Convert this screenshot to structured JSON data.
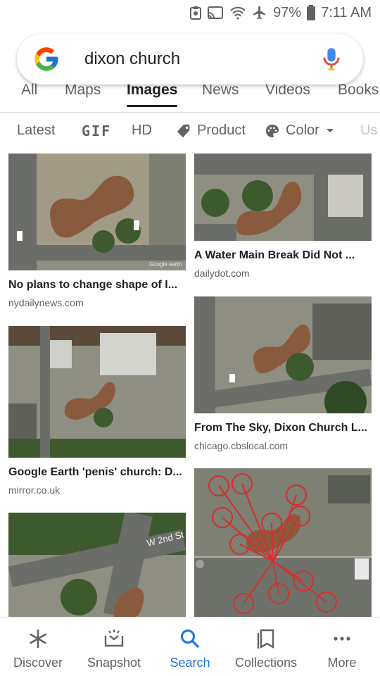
{
  "status_bar": {
    "battery": "97%",
    "time": "7:11 AM"
  },
  "search": {
    "query": "dixon church"
  },
  "tabs": [
    {
      "label": "All"
    },
    {
      "label": "Maps"
    },
    {
      "label": "Images"
    },
    {
      "label": "News"
    },
    {
      "label": "Videos"
    },
    {
      "label": "Books"
    }
  ],
  "filters": {
    "latest": "Latest",
    "gif": "GIF",
    "hd": "HD",
    "product": "Product",
    "color": "Color",
    "usage": "Us"
  },
  "results": [
    {
      "title": "No plans to change shape of I...",
      "source": "nydailynews.com"
    },
    {
      "title": "A Water Main Break Did Not ...",
      "source": "dailydot.com"
    },
    {
      "title": "Google Earth 'penis' church: D...",
      "source": "mirror.co.uk"
    },
    {
      "title": "From The Sky, Dixon Church L...",
      "source": "chicago.cbslocal.com"
    }
  ],
  "image_text": {
    "street_label": "W 2nd St",
    "watermark": "Google earth"
  },
  "bottom_nav": {
    "discover": "Discover",
    "snapshot": "Snapshot",
    "search": "Search",
    "collections": "Collections",
    "more": "More"
  },
  "colors": {
    "accent": "#1a73e8",
    "building": "#8a5a3c",
    "ground": "#8c8f7e"
  }
}
